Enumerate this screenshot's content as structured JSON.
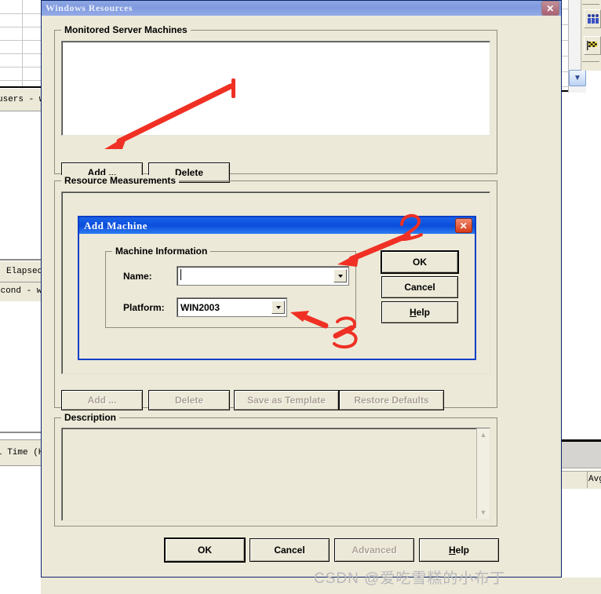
{
  "background": {
    "left_labels": [
      "users - w",
      "Elapsed",
      "econd - w",
      "l Time (H"
    ],
    "right_labels": [
      "Avg"
    ],
    "toolbar_icons": [
      "users-icon",
      "flag-icon"
    ],
    "scroll_icon": "chevron-down-icon"
  },
  "window": {
    "title": "Windows Resources",
    "close_icon": "close-icon",
    "groups": {
      "monitored": {
        "legend": "Monitored Server Machines",
        "add_label": "Add ...",
        "delete_label": "Delete"
      },
      "measurements": {
        "legend": "Resource Measurements",
        "add_label": "Add ...",
        "delete_label": "Delete",
        "save_template_label": "Save as Template",
        "restore_defaults_label": "Restore Defaults"
      },
      "description": {
        "legend": "Description",
        "value": "",
        "scroll_up_icon": "chevron-up-icon",
        "scroll_down_icon": "chevron-down-icon"
      }
    },
    "footer": {
      "ok_label": "OK",
      "cancel_label": "Cancel",
      "advanced_label": "Advanced",
      "help_label": "Help",
      "help_accel": "H"
    }
  },
  "dialog": {
    "title": "Add Machine",
    "close_icon": "close-icon",
    "group_legend": "Machine Information",
    "fields": {
      "name": {
        "label": "Name:",
        "value": "",
        "dropdown_icon": "chevron-down-icon"
      },
      "platform": {
        "label": "Platform:",
        "value": "WIN2003",
        "dropdown_icon": "chevron-down-icon"
      }
    },
    "buttons": {
      "ok_label": "OK",
      "cancel_label": "Cancel",
      "help_label": "Help",
      "help_accel": "H"
    }
  },
  "annotations": {
    "color": "#f03024",
    "marks": [
      {
        "name": "mark-1",
        "text": "1",
        "kind": "digit-plus-arrow"
      },
      {
        "name": "mark-2",
        "text": "2",
        "kind": "digit-plus-arrow"
      },
      {
        "name": "mark-3",
        "text": "3",
        "kind": "digit-plus-arrow"
      }
    ]
  },
  "watermark": {
    "text": "CSDN @爱吃雪糕的小布丁"
  }
}
